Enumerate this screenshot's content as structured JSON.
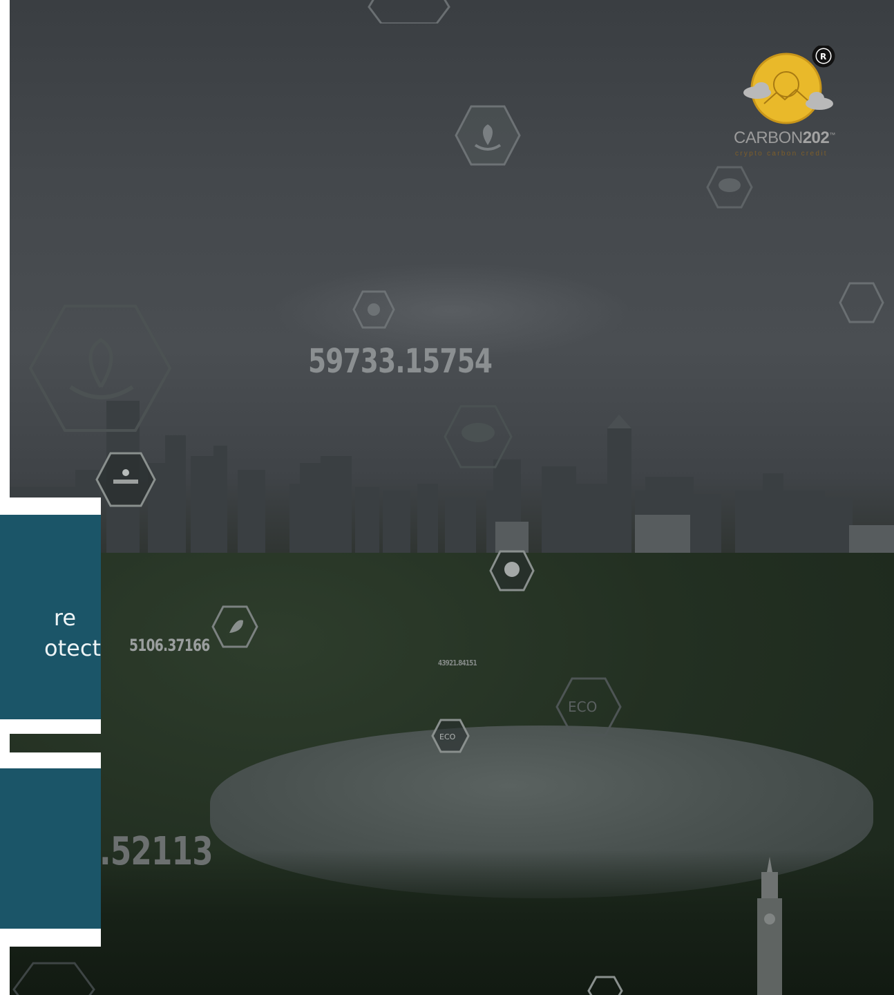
{
  "brand": {
    "name_light": "CARBON",
    "name_bold": "202",
    "tm": "™",
    "registered": "R",
    "tagline": "crypto carbon credit"
  },
  "hero": {
    "floating_numbers": [
      "59733.15754",
      "5106.37166",
      ".52113",
      "43921.84151"
    ],
    "icon_labels": [
      "ECO",
      "ECO"
    ]
  },
  "cards": [
    {
      "line1": "re",
      "line2": "otect"
    },
    {
      "line1": "",
      "line2": ""
    }
  ],
  "colors": {
    "card_panel": "#1b5568",
    "logo_gold": "#e9b92a",
    "overlay": "#3f4347"
  }
}
